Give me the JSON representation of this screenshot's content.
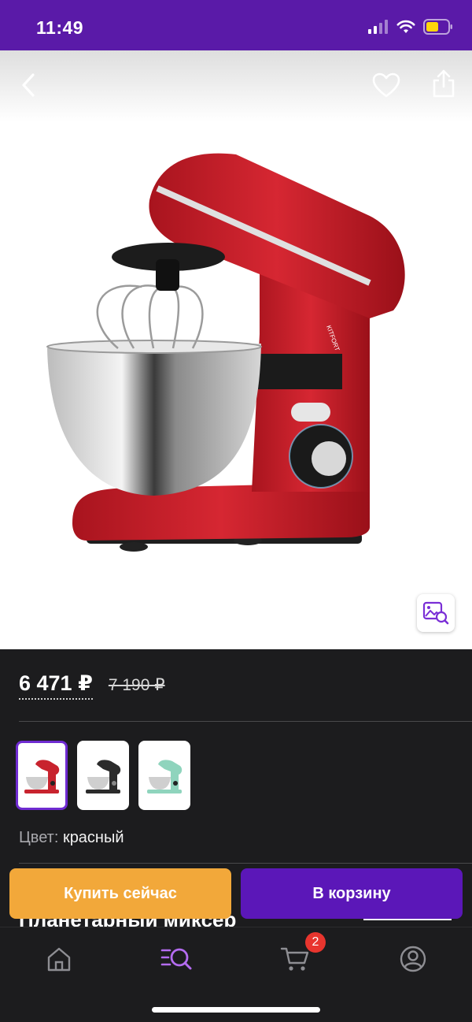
{
  "status_bar": {
    "time": "11:49",
    "icons": [
      "cellular-signal-icon",
      "wifi-icon",
      "battery-icon"
    ],
    "bar_color": "#5a1aa8"
  },
  "product_header": {
    "icons": [
      "back-chevron-icon",
      "heart-icon",
      "share-icon"
    ],
    "search_by_image_icon": "image-search-icon",
    "product_image": "red stand mixer with stainless bowl"
  },
  "price": {
    "current": "6 471 ₽",
    "old": "7 190 ₽"
  },
  "variants": [
    {
      "color_name": "red",
      "color": "#c8232e",
      "selected": true
    },
    {
      "color_name": "black",
      "color": "#2b2b2b",
      "selected": false
    },
    {
      "color_name": "mint",
      "color": "#8fd4bd",
      "selected": false
    }
  ],
  "color_selection": {
    "label": "Цвет:",
    "value": "красный"
  },
  "title_peek": "Планетарный миксер",
  "actions": {
    "buy_now": "Купить сейчас",
    "add_to_cart": "В корзину"
  },
  "tab_bar": {
    "tabs": [
      "home-icon",
      "catalog-search-icon",
      "cart-icon",
      "profile-icon"
    ],
    "active_tab": "catalog-search-icon",
    "cart_badge": "2"
  },
  "colors": {
    "accent": "#6f2bd1",
    "buy_button": "#f2a83a",
    "cart_button": "#5b17b8",
    "background": "#1c1c1e",
    "badge": "#e8352e"
  }
}
